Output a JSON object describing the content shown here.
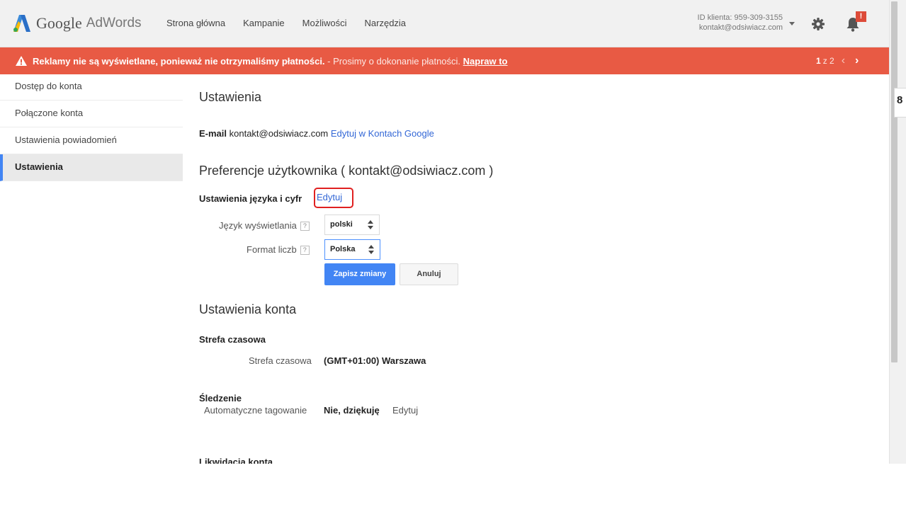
{
  "header": {
    "logo_google": "Google",
    "logo_product": "AdWords",
    "nav": [
      "Strona główna",
      "Kampanie",
      "Możliwości",
      "Narzędzia"
    ],
    "client_id": "ID klienta: 959-309-3155",
    "client_email": "kontakt@odsiwiacz.com",
    "notification_badge": "!"
  },
  "alert": {
    "bold": "Reklamy nie są wyświetlane, ponieważ nie otrzymaliśmy płatności.",
    "sub": " - Prosimy o dokonanie płatności. ",
    "link": "Napraw to",
    "page_current": "1",
    "page_rest": "z 2",
    "prev": "‹",
    "next": "›"
  },
  "sidebar": {
    "items": [
      "Dostęp do konta",
      "Połączone konta",
      "Ustawienia powiadomień",
      "Ustawienia"
    ],
    "active_index": 3
  },
  "main": {
    "title": "Ustawienia",
    "email_label": "E-mail",
    "email_value": " kontakt@odsiwiacz.com ",
    "email_edit_link": "Edytuj w Kontach Google",
    "prefs_title": "Preferencje użytkownika ( kontakt@odsiwiacz.com )",
    "lang_section_label": "Ustawienia języka i cyfr",
    "lang_edit_link": "Edytuj",
    "display_lang_label": "Język wyświetlania",
    "display_lang_value": "polski",
    "number_format_label": "Format liczb",
    "number_format_value": "Polska",
    "help_glyph": "?",
    "save_button": "Zapisz zmiany",
    "cancel_button": "Anuluj",
    "account_title": "Ustawienia konta",
    "timezone_section": "Strefa czasowa",
    "timezone_label": "Strefa czasowa",
    "timezone_value": "(GMT+01:00) Warszawa",
    "tracking_section": "Śledzenie",
    "autotag_label": "Automatyczne tagowanie",
    "autotag_value": "Nie, dziękuję",
    "autotag_edit_link": "Edytuj",
    "closure_section": "Likwidacja konta"
  },
  "edge_tab_text": "8",
  "colors": {
    "alert_bg": "#e85a44",
    "primary_button": "#4285f4",
    "link": "#3367d6",
    "active_marker": "#4285f4",
    "highlight_box": "#e02020"
  }
}
